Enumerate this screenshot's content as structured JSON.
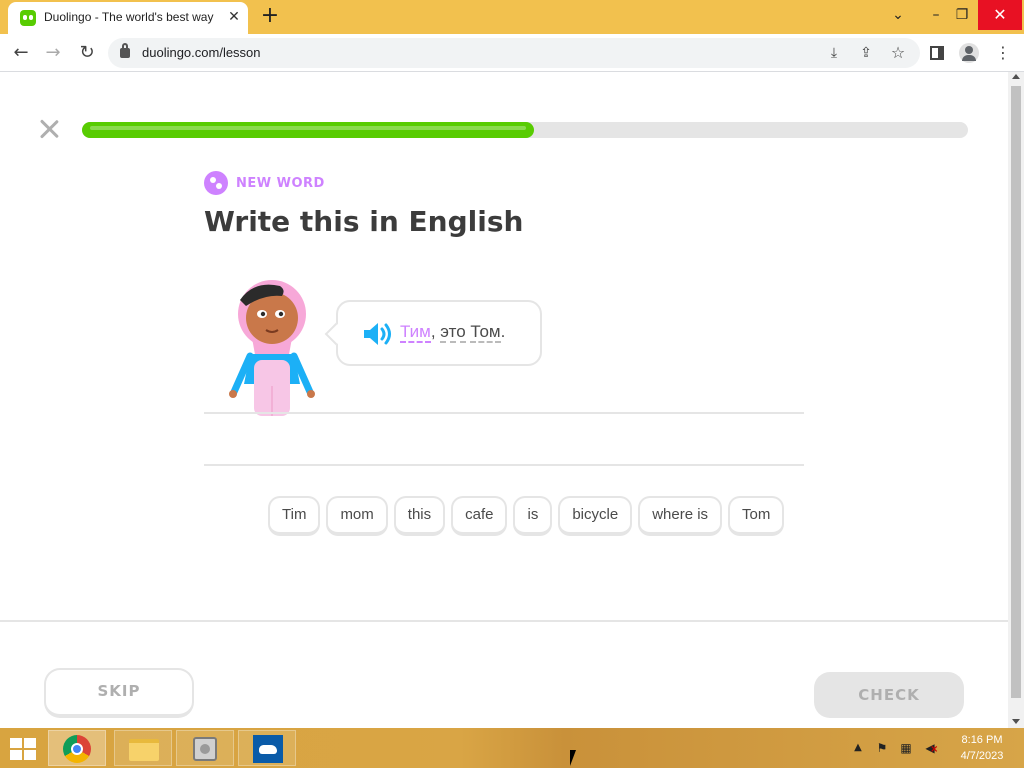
{
  "browser": {
    "tab_title": "Duolingo - The world's best way",
    "tab_close": "✕",
    "new_tab": "+",
    "tab_search": "⌄",
    "minimize": "–",
    "restore": "❐",
    "close": "✕",
    "back": "←",
    "forward": "→",
    "reload": "↻",
    "url": "duolingo.com/lesson",
    "install": "⤓",
    "share": "⇪",
    "bookmark": "☆",
    "menu": "⋮"
  },
  "lesson": {
    "progress": 0.51,
    "badge_label": "NEW WORD",
    "instruction": "Write this in English",
    "prompt": {
      "highlighted_word": "Тим",
      "comma": ",",
      "word2": "это",
      "word3": "Том",
      "period": "."
    },
    "word_bank": [
      "Tim",
      "mom",
      "this",
      "cafe",
      "is",
      "bicycle",
      "where is",
      "Tom"
    ],
    "skip_label": "SKIP",
    "check_label": "CHECK"
  },
  "taskbar": {
    "tray_up": "▲",
    "tray_flag": "⚑",
    "tray_network": "▦",
    "tray_volume": "◀",
    "time": "8:16 PM",
    "date": "4/7/2023"
  },
  "colors": {
    "brand_green": "#58cc02",
    "new_word_purple": "#ce82ff",
    "speaker_blue": "#1cb0f6",
    "taskbar": "#d8a440"
  }
}
